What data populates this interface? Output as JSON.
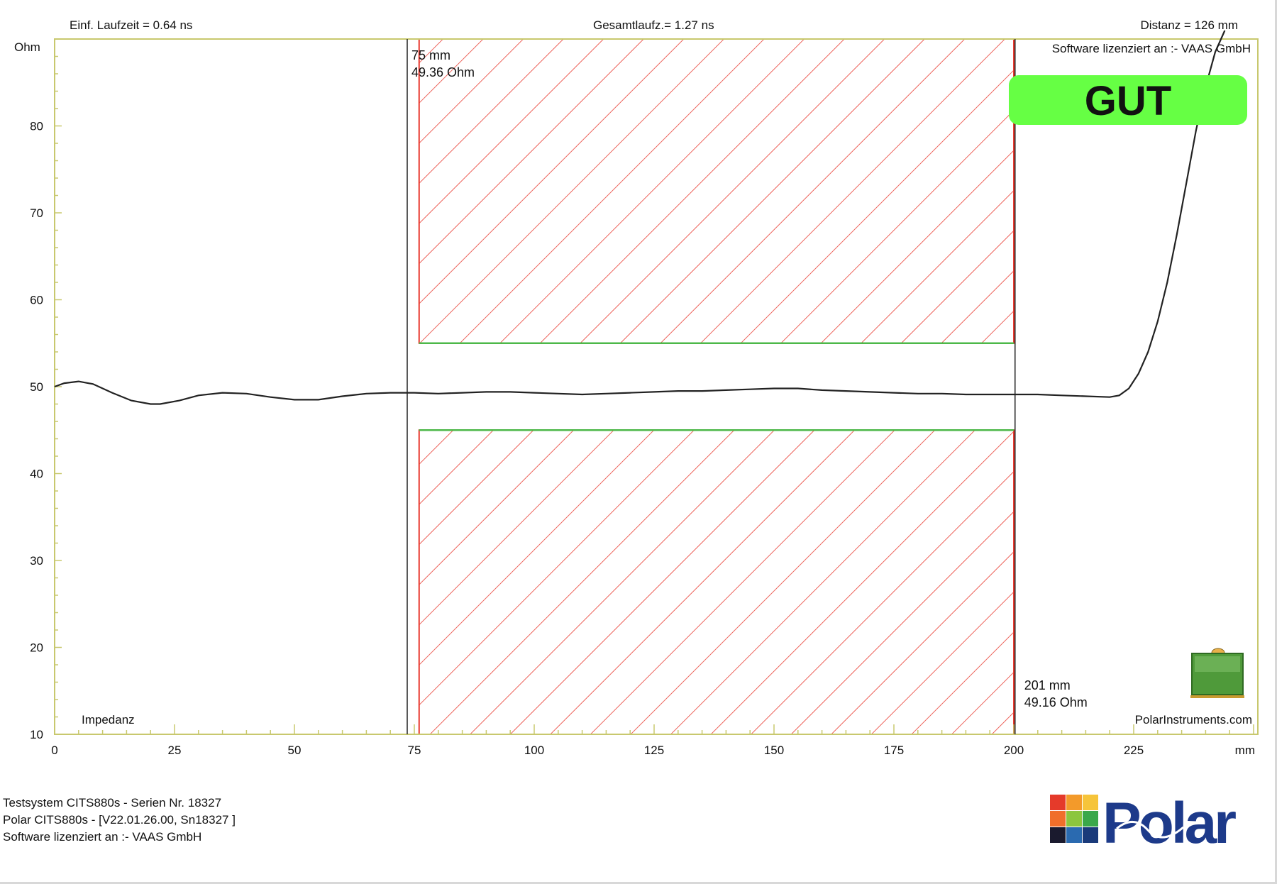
{
  "header": {
    "left": "Einf. Laufzeit = 0.64 ns",
    "middle": "Gesamtlaufz.= 1.27 ns",
    "right": "Distanz = 126 mm"
  },
  "footer": {
    "line1": "Testsystem CITS880s - Serien Nr. 18327",
    "line2": "Polar CITS880s -  [V22.01.26.00, Sn18327 ]",
    "line3": "Software lizenziert an :- VAAS GmbH"
  },
  "logo": {
    "text": "Polar"
  },
  "colors": {
    "frame": "#c8c86e",
    "limit_red": "#e83a30",
    "limit_green": "#4db848",
    "status_green": "#66ff44",
    "trace": "#222222",
    "icon_green": "#4f9a3a"
  },
  "chart_data": {
    "type": "line",
    "ylabel": "Ohm",
    "xlabel": "mm",
    "xlim": [
      0,
      250
    ],
    "ylim": [
      10,
      90
    ],
    "x_ticks": [
      0,
      25,
      50,
      75,
      100,
      125,
      150,
      175,
      200,
      225
    ],
    "y_ticks": [
      10,
      20,
      30,
      40,
      50,
      60,
      70,
      80
    ],
    "grid": false,
    "watermark": "Software lizenziert an :- VAAS GmbH",
    "status": "GUT",
    "trace_label": "Impedanz",
    "site_label": "PolarInstruments.com",
    "cursors": [
      {
        "x": 75,
        "label_distance": "75 mm",
        "label_value": "49.36 Ohm"
      },
      {
        "x": 201,
        "label_distance": "201 mm",
        "label_value": "49.16 Ohm"
      }
    ],
    "limits": {
      "x_start": 76,
      "x_end": 200,
      "upper": [
        55,
        90
      ],
      "lower": [
        10,
        45
      ]
    },
    "series": [
      {
        "x": [
          0,
          2,
          5,
          8,
          12,
          16,
          20,
          22,
          26,
          30,
          35,
          40,
          45,
          50,
          55,
          60,
          65,
          70,
          75,
          80,
          85,
          90,
          95,
          100,
          105,
          110,
          115,
          120,
          125,
          130,
          135,
          140,
          145,
          150,
          155,
          160,
          165,
          170,
          175,
          180,
          185,
          190,
          195,
          200,
          205,
          210,
          215,
          220,
          222,
          224,
          226,
          228,
          230,
          232,
          234,
          236,
          238,
          240,
          242,
          244
        ],
        "values": [
          50.0,
          50.4,
          50.6,
          50.3,
          49.3,
          48.4,
          48.0,
          48.0,
          48.4,
          49.0,
          49.3,
          49.2,
          48.8,
          48.5,
          48.5,
          48.9,
          49.2,
          49.3,
          49.3,
          49.2,
          49.3,
          49.4,
          49.4,
          49.3,
          49.2,
          49.1,
          49.2,
          49.3,
          49.4,
          49.5,
          49.5,
          49.6,
          49.7,
          49.8,
          49.8,
          49.6,
          49.5,
          49.4,
          49.3,
          49.2,
          49.2,
          49.1,
          49.1,
          49.1,
          49.1,
          49.0,
          48.9,
          48.8,
          49.0,
          49.8,
          51.5,
          54.0,
          57.5,
          62.0,
          67.5,
          73.5,
          79.5,
          84.5,
          88.5,
          91.0
        ]
      }
    ]
  }
}
